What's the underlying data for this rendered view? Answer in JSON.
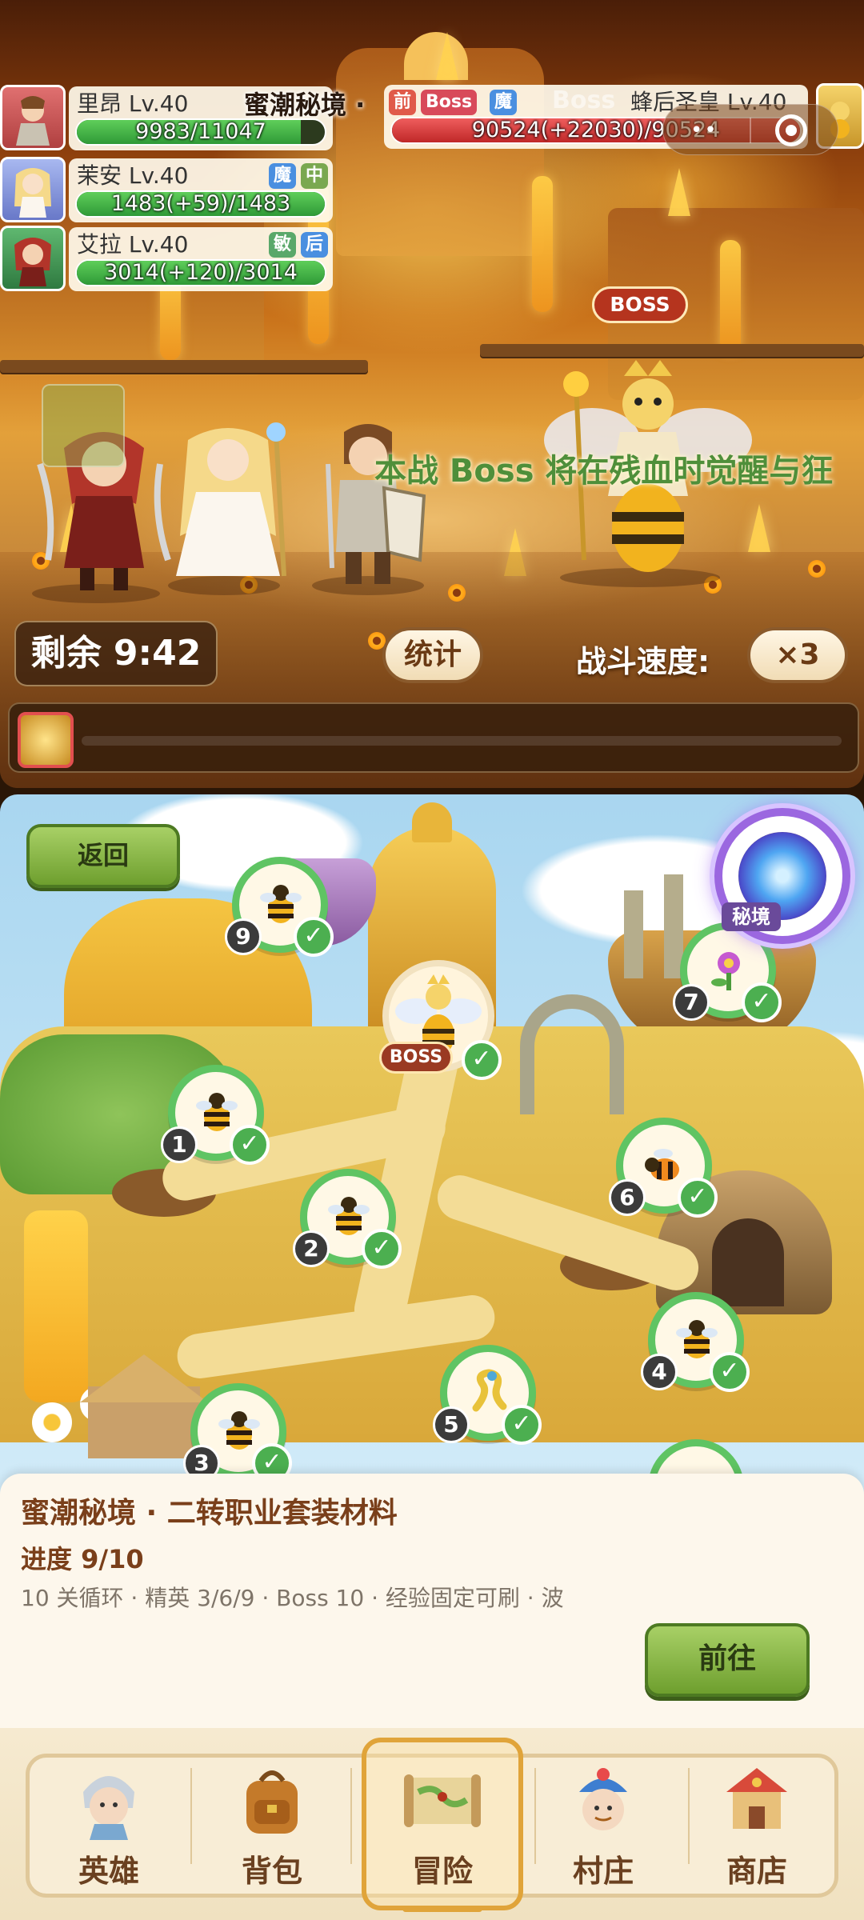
{
  "battle": {
    "stage_title": "蜜潮秘境 ·",
    "boss_label_faded": "Boss",
    "boss_sign": "BOSS",
    "scrolling_text": "本战 Boss 将在残血时觉醒与狂",
    "timer": "剩余 9:42",
    "stats_button": "统计",
    "speed_label": "战斗速度:",
    "speed_value": "×3",
    "capsule_dots": "••",
    "party": [
      {
        "name": "里昂 Lv.40",
        "hp": "9983/11047",
        "hp_ratio": 0.9037,
        "tags": []
      },
      {
        "name": "茉安 Lv.40",
        "hp": "1483(+59)/1483",
        "hp_ratio": 1.0,
        "tags": [
          "魔",
          "中"
        ]
      },
      {
        "name": "艾拉 Lv.40",
        "hp": "3014(+120)/3014",
        "hp_ratio": 1.0,
        "tags": [
          "敏",
          "后"
        ]
      }
    ],
    "boss": {
      "name": "蜂后圣皇 Lv.40",
      "hp": "90524(+22030)/90524",
      "hp_ratio": 1.0,
      "tags": [
        "前",
        "Boss",
        "魔"
      ]
    }
  },
  "map": {
    "back_button": "返回",
    "portal_label": "秘境",
    "boss_node_label": "BOSS",
    "nodes": [
      {
        "num": "1",
        "cleared": "✓"
      },
      {
        "num": "2",
        "cleared": "✓"
      },
      {
        "num": "3",
        "cleared": "✓"
      },
      {
        "num": "4",
        "cleared": "✓"
      },
      {
        "num": "5",
        "cleared": "✓"
      },
      {
        "num": "6",
        "cleared": "✓"
      },
      {
        "num": "7",
        "cleared": "✓"
      },
      {
        "num": "9",
        "cleared": "✓"
      }
    ],
    "boss_cleared": "✓"
  },
  "info": {
    "title": "蜜潮秘境 · 二转职业套装材料",
    "progress": "进度 9/10",
    "description": "10 关循环 · 精英 3/6/9 · Boss 10 · 经验固定可刷 · 波",
    "go_button": "前往"
  },
  "nav": {
    "items": [
      {
        "label": "英雄",
        "icon": "hero-icon"
      },
      {
        "label": "背包",
        "icon": "backpack-icon"
      },
      {
        "label": "冒险",
        "icon": "adventure-map-icon"
      },
      {
        "label": "村庄",
        "icon": "village-icon"
      },
      {
        "label": "商店",
        "icon": "shop-icon"
      }
    ],
    "active_index": 2
  },
  "colors": {
    "hp_green": "#3fae42",
    "hp_red": "#d43a3a",
    "node_green": "#5fc463",
    "button_green": "#8dbb4a",
    "brown_text": "#7a3f1a",
    "active_tab": "#e0a43a"
  }
}
